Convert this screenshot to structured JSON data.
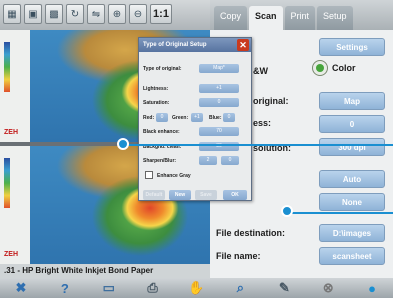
{
  "toolbar": {
    "buttons": [
      "view-icon",
      "fit-icon",
      "image-icon",
      "rotate-icon",
      "mirror-icon",
      "zoom-in-icon",
      "zoom-out-icon"
    ],
    "zoom_label": "1:1"
  },
  "tabs": [
    {
      "label": "Copy",
      "active": false
    },
    {
      "label": "Scan",
      "active": true
    },
    {
      "label": "Print",
      "active": false
    },
    {
      "label": "Setup",
      "active": false
    }
  ],
  "panel": {
    "settings_label": "Settings",
    "bw_label": "&W",
    "color_label": "Color",
    "original_label": "original:",
    "original_value": "Map",
    "ess_label": "ess:",
    "ess_value": "0",
    "resolution_label": "solution:",
    "resolution_value": "300 dpi",
    "auto_value": "Auto",
    "none_value": "None",
    "file_destination_label": "File destination:",
    "file_destination_value": "D:\\images",
    "file_name_label": "File name:",
    "file_name_value": "scansheet"
  },
  "preview": {
    "paper_label": ".31 - HP Bright White Inkjet Bond Paper",
    "logo_text": "ZEH"
  },
  "dialog": {
    "title": "Type of Original Setup",
    "type_label": "Type of original:",
    "type_value": "Map*",
    "lightness_label": "Lightness:",
    "lightness_value": "+1",
    "saturation_label": "Saturation:",
    "saturation_value": "0",
    "red_label": "Red:",
    "red_value": "0",
    "green_label": "Green:",
    "green_value": "+1",
    "blue_label": "Blue:",
    "blue_value": "0",
    "black_label": "Black enhance:",
    "black_value": "70",
    "backgnd_label": "Backgnd. clean:",
    "backgnd_value": "30",
    "sharpen_label": "Sharpen/Blur:",
    "sharpen_value_a": "2",
    "sharpen_value_b": "0",
    "enhance_gray_label": "Enhance Gray",
    "btn_default": "Default",
    "btn_new": "New",
    "btn_save": "Save",
    "btn_ok": "OK"
  },
  "bottombar": {
    "icons": [
      "close-icon",
      "help-icon",
      "folder-icon",
      "print-icon",
      "hand-icon",
      "search-icon",
      "edit-icon",
      "cancel-icon",
      "play-icon"
    ]
  },
  "colors": {
    "accent": "#1a8fd1",
    "button_blue": "#8fb3d7",
    "close_red": "#c93a1e",
    "radio_green": "#46a53b"
  }
}
